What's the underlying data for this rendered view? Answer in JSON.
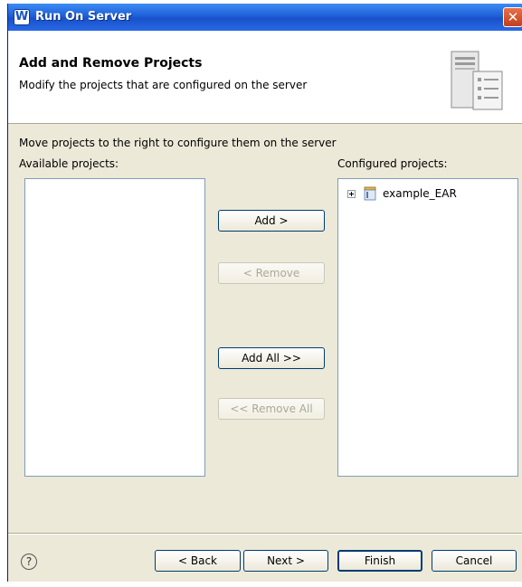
{
  "window": {
    "title": "Run On Server",
    "app_icon": "W"
  },
  "header": {
    "title": "Add and Remove Projects",
    "description": "Modify the projects that are configured on the server"
  },
  "main": {
    "instruction": "Move projects to the right to configure them on the server",
    "available_label": "Available projects:",
    "configured_label": "Configured projects:",
    "available_projects": [],
    "configured_projects": [
      {
        "label": "example_EAR",
        "icon": "ear-project-icon",
        "expandable": true
      }
    ],
    "buttons": {
      "add": "Add >",
      "remove": "< Remove",
      "add_all": "Add All >>",
      "remove_all": "<< Remove All"
    }
  },
  "footer": {
    "help_icon": "?",
    "back": "< Back",
    "next": "Next >",
    "finish": "Finish",
    "cancel": "Cancel"
  }
}
